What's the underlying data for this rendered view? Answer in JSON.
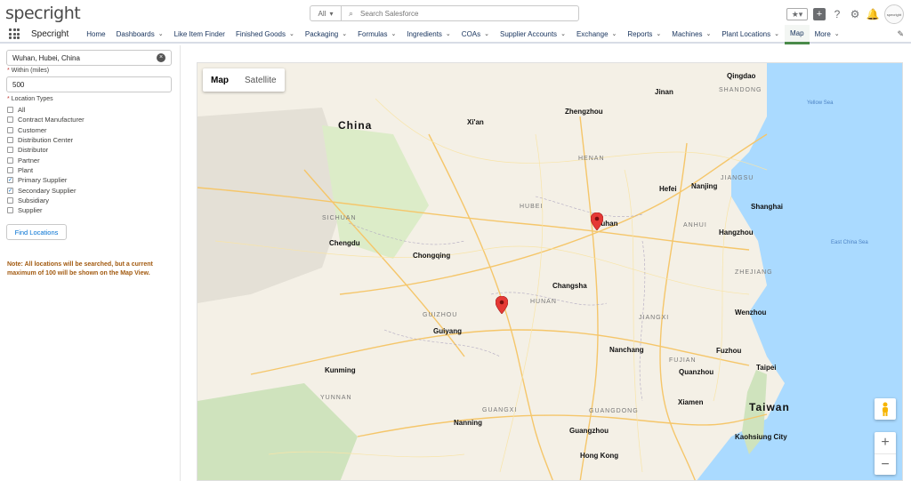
{
  "brand": {
    "logo": "specright"
  },
  "search": {
    "scope": "All",
    "placeholder": "Search Salesforce"
  },
  "header_icons": [
    "star-icon",
    "plus-icon",
    "help-icon",
    "gear-icon",
    "bell-icon",
    "avatar"
  ],
  "avatar_text": "specright",
  "nav": {
    "app_name": "Specright",
    "items": [
      {
        "label": "Home",
        "chevron": false
      },
      {
        "label": "Dashboards",
        "chevron": true
      },
      {
        "label": "Like Item Finder",
        "chevron": false
      },
      {
        "label": "Finished Goods",
        "chevron": true
      },
      {
        "label": "Packaging",
        "chevron": true
      },
      {
        "label": "Formulas",
        "chevron": true
      },
      {
        "label": "Ingredients",
        "chevron": true
      },
      {
        "label": "COAs",
        "chevron": true
      },
      {
        "label": "Supplier Accounts",
        "chevron": true
      },
      {
        "label": "Exchange",
        "chevron": true
      },
      {
        "label": "Reports",
        "chevron": true
      },
      {
        "label": "Machines",
        "chevron": true
      },
      {
        "label": "Plant Locations",
        "chevron": true
      },
      {
        "label": "Map",
        "chevron": false,
        "active": true
      },
      {
        "label": "More",
        "chevron": true
      }
    ]
  },
  "sidebar": {
    "location_value": "Wuhan, Hubei, China",
    "within_label": "Within (miles)",
    "within_value": "500",
    "types_label": "Location Types",
    "types": [
      {
        "label": "All",
        "checked": false
      },
      {
        "label": "Contract Manufacturer",
        "checked": false
      },
      {
        "label": "Customer",
        "checked": false
      },
      {
        "label": "Distribution Center",
        "checked": false
      },
      {
        "label": "Distributor",
        "checked": false
      },
      {
        "label": "Partner",
        "checked": false
      },
      {
        "label": "Plant",
        "checked": false
      },
      {
        "label": "Primary Supplier",
        "checked": true
      },
      {
        "label": "Secondary Supplier",
        "checked": true
      },
      {
        "label": "Subsidiary",
        "checked": false
      },
      {
        "label": "Supplier",
        "checked": false
      }
    ],
    "find_button": "Find Locations",
    "note": "Note: All locations will be searched, but a current maximum of 100 will be shown on the Map View."
  },
  "map": {
    "toggle": [
      "Map",
      "Satellite"
    ],
    "labels": [
      {
        "text": "China",
        "cls": "big"
      },
      {
        "text": "Chengdu",
        "cls": "city"
      },
      {
        "text": "Chongqing",
        "cls": "city"
      },
      {
        "text": "Zhengzhou",
        "cls": "city"
      },
      {
        "text": "Xi'an",
        "cls": "city"
      },
      {
        "text": "Wuhan",
        "cls": "city"
      },
      {
        "text": "Changsha",
        "cls": "city"
      },
      {
        "text": "Nanjing",
        "cls": "city"
      },
      {
        "text": "Hefei",
        "cls": "city"
      },
      {
        "text": "Shanghai",
        "cls": "city"
      },
      {
        "text": "Hangzhou",
        "cls": "city"
      },
      {
        "text": "Qingdao",
        "cls": "city"
      },
      {
        "text": "Jinan",
        "cls": "city"
      },
      {
        "text": "Kunming",
        "cls": "city"
      },
      {
        "text": "Guiyang",
        "cls": "city"
      },
      {
        "text": "Nanning",
        "cls": "city"
      },
      {
        "text": "Guangzhou",
        "cls": "city"
      },
      {
        "text": "Hong Kong",
        "cls": "city"
      },
      {
        "text": "Xiamen",
        "cls": "city"
      },
      {
        "text": "Fuzhou",
        "cls": "city"
      },
      {
        "text": "Taipei",
        "cls": "city"
      },
      {
        "text": "Taiwan",
        "cls": "big"
      },
      {
        "text": "Kaohsiung City",
        "cls": "city"
      },
      {
        "text": "Wenzhou",
        "cls": "city"
      },
      {
        "text": "Nanchang",
        "cls": "city"
      },
      {
        "text": "Quanzhou",
        "cls": "city"
      },
      {
        "text": "HUBEI",
        "cls": "prov"
      },
      {
        "text": "HUNAN",
        "cls": "prov"
      },
      {
        "text": "HENAN",
        "cls": "prov"
      },
      {
        "text": "SICHUAN",
        "cls": "prov"
      },
      {
        "text": "GUIZHOU",
        "cls": "prov"
      },
      {
        "text": "YUNNAN",
        "cls": "prov"
      },
      {
        "text": "GUANGXI",
        "cls": "prov"
      },
      {
        "text": "GUANGDONG",
        "cls": "prov"
      },
      {
        "text": "JIANGXI",
        "cls": "prov"
      },
      {
        "text": "FUJIAN",
        "cls": "prov"
      },
      {
        "text": "ZHEJIANG",
        "cls": "prov"
      },
      {
        "text": "ANHUI",
        "cls": "prov"
      },
      {
        "text": "JIANGSU",
        "cls": "prov"
      },
      {
        "text": "SHANDONG",
        "cls": "prov"
      },
      {
        "text": "Yellow Sea",
        "cls": "sea"
      },
      {
        "text": "East China Sea",
        "cls": "sea"
      }
    ]
  }
}
